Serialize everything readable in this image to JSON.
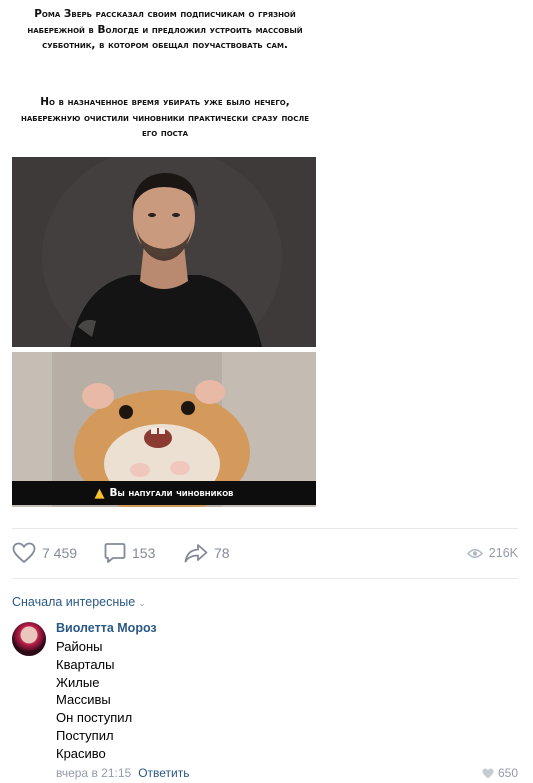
{
  "post": {
    "caption_line1": "Рома Зверь рассказал своим подписчикам о грязной набережной в Вологде и предложил устроить массовый субботник, в котором обещал поучаствовать сам.",
    "caption_line2": "Но в назначенное время убирать уже было нечего, набережную очистили чиновники практически сразу после его поста",
    "meme_warning": "Вы напугали чиновников"
  },
  "actions": {
    "likes": "7 459",
    "comments": "153",
    "shares": "78",
    "views": "216K"
  },
  "comments_section": {
    "sort_label": "Сначала интересные",
    "comment": {
      "author": "Виолетта Мороз",
      "lines": [
        "Районы",
        "Кварталы",
        "Жилые",
        "Массивы",
        "Он поступил",
        "Поступил",
        "Красиво"
      ],
      "time": "вчера в 21:15",
      "reply_label": "Ответить",
      "likes": "650"
    }
  },
  "colors": {
    "link": "#2a5885",
    "muted": "#828a99",
    "warning": "#f6c22e"
  }
}
